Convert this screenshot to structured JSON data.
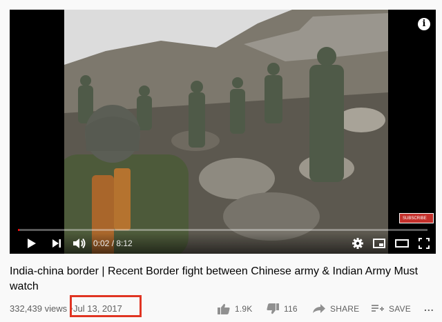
{
  "player": {
    "time_current": "0:02",
    "time_separator": " / ",
    "time_total": "8:12",
    "progress_fraction": 0.004,
    "info_label": "i",
    "subscribe_label": "SUBSCRIBE"
  },
  "video": {
    "title": "India-china border | Recent Border fight between Chinese army & Indian Army Must watch",
    "views": "332,439 views",
    "separator": "•",
    "date": "Jul 13, 2017"
  },
  "actions": {
    "like_count": "1.9K",
    "dislike_count": "116",
    "share_label": "SHARE",
    "save_label": "SAVE",
    "more_label": "..."
  },
  "colors": {
    "highlight_box": "#e03422",
    "progress": "#ff0000"
  },
  "icons": {
    "play": "play-icon",
    "next": "next-icon",
    "volume": "volume-icon",
    "settings": "gear-icon",
    "miniplayer": "miniplayer-icon",
    "theater": "theater-icon",
    "fullscreen": "fullscreen-icon",
    "like": "thumbs-up-icon",
    "dislike": "thumbs-down-icon",
    "share": "share-icon",
    "save": "playlist-add-icon"
  }
}
